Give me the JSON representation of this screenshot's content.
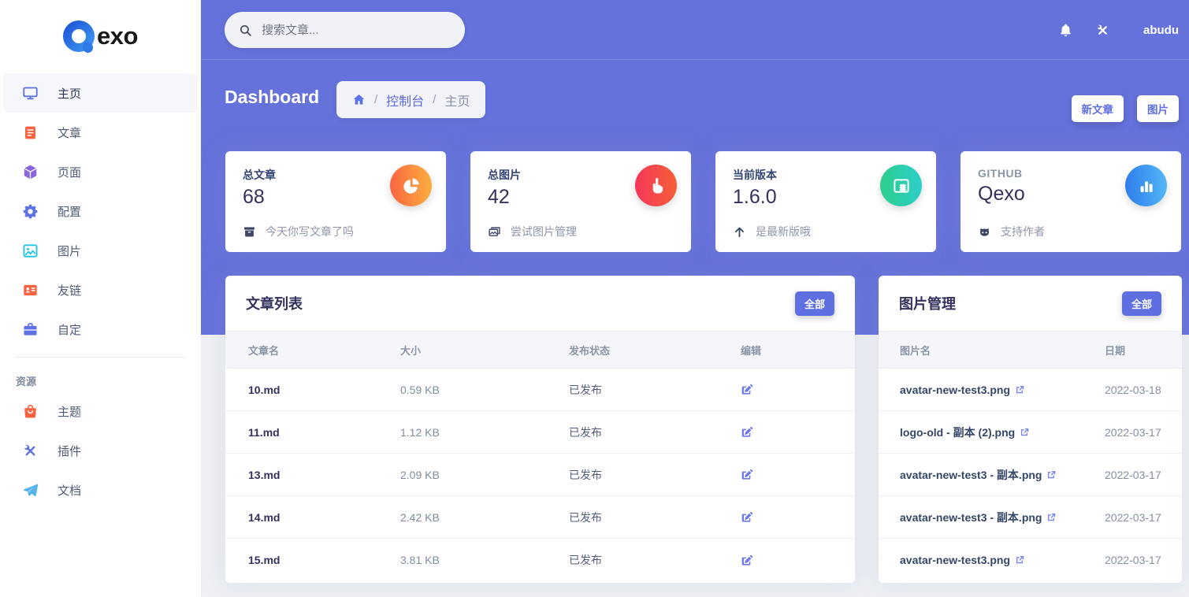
{
  "colors": {
    "primary": "#5e72e4",
    "header_purple": "#6672dc",
    "orange": "#fb6340",
    "red": "#f5365c",
    "green": "#2dce89",
    "blue": "#2e7ceb",
    "cyan": "#11cdef",
    "text_dark": "#32325d",
    "text_muted": "#8898aa"
  },
  "brand": {
    "logo_text": "exo"
  },
  "topbar": {
    "search_placeholder": "搜索文章...",
    "username": "abudu"
  },
  "sidebar": {
    "items": [
      {
        "label": "主页"
      },
      {
        "label": "文章"
      },
      {
        "label": "页面"
      },
      {
        "label": "配置"
      },
      {
        "label": "图片"
      },
      {
        "label": "友链"
      },
      {
        "label": "自定"
      }
    ],
    "section_label": "资源",
    "resources": [
      {
        "label": "主题"
      },
      {
        "label": "插件"
      },
      {
        "label": "文档"
      }
    ]
  },
  "page_header": {
    "title": "Dashboard",
    "breadcrumb": {
      "sep": "/",
      "crumbs": [
        "控制台",
        "主页"
      ]
    },
    "buttons": {
      "new_post": "新文章",
      "image": "图片"
    }
  },
  "stats": [
    {
      "label": "总文章",
      "value": "68",
      "caption": "今天你写文章了吗"
    },
    {
      "label": "总图片",
      "value": "42",
      "caption": "尝试图片管理"
    },
    {
      "label": "当前版本",
      "value": "1.6.0",
      "caption": "是最新版哦"
    },
    {
      "label": "GITHUB",
      "value": "Qexo",
      "caption": "支持作者"
    }
  ],
  "articles": {
    "title": "文章列表",
    "all_button": "全部",
    "columns": [
      "文章名",
      "大小",
      "发布状态",
      "编辑"
    ],
    "rows": [
      {
        "name": "10.md",
        "size": "0.59 KB",
        "status": "已发布"
      },
      {
        "name": "11.md",
        "size": "1.12 KB",
        "status": "已发布"
      },
      {
        "name": "13.md",
        "size": "2.09 KB",
        "status": "已发布"
      },
      {
        "name": "14.md",
        "size": "2.42 KB",
        "status": "已发布"
      },
      {
        "name": "15.md",
        "size": "3.81 KB",
        "status": "已发布"
      }
    ]
  },
  "images_panel": {
    "title": "图片管理",
    "all_button": "全部",
    "columns": [
      "图片名",
      "日期"
    ],
    "rows": [
      {
        "name": "avatar-new-test3.png",
        "date": "2022-03-18"
      },
      {
        "name": "logo-old - 副本 (2).png",
        "date": "2022-03-17"
      },
      {
        "name": "avatar-new-test3 - 副本.png",
        "date": "2022-03-17"
      },
      {
        "name": "avatar-new-test3 - 副本.png",
        "date": "2022-03-17"
      },
      {
        "name": "avatar-new-test3.png",
        "date": "2022-03-17"
      }
    ]
  }
}
